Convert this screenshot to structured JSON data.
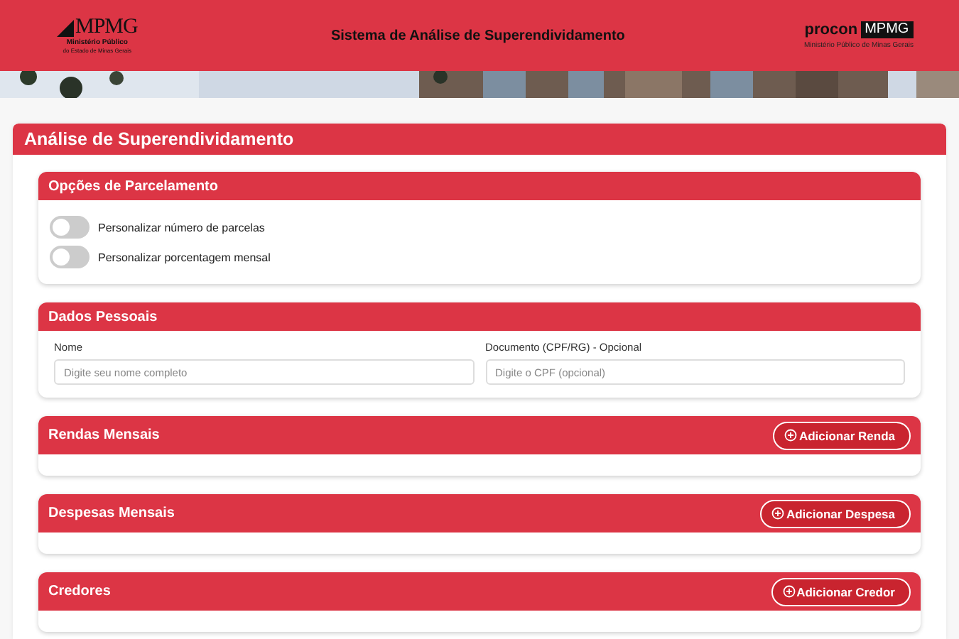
{
  "header": {
    "logo_left": {
      "mark": "MPMG",
      "line1": "Ministério Público",
      "line2": "do Estado de Minas Gerais"
    },
    "title": "Sistema de Análise de Superendividamento",
    "logo_right": {
      "word": "procon",
      "tag": "MPMG",
      "line": "Ministério Público de Minas Gerais"
    }
  },
  "main": {
    "title": "Análise de Superendividamento",
    "sections": [
      {
        "kind": "toggles",
        "title": "Opções de Parcelamento",
        "toggles": [
          {
            "label": "Personalizar número de parcelas",
            "on": false
          },
          {
            "label": "Personalizar porcentagem mensal",
            "on": false
          }
        ]
      },
      {
        "kind": "fields",
        "title": "Dados Pessoais",
        "fields": [
          {
            "label": "Nome",
            "placeholder": "Digite seu nome completo"
          },
          {
            "label": "Documento (CPF/RG) - Opcional",
            "placeholder": "Digite o CPF (opcional)"
          }
        ]
      },
      {
        "kind": "list",
        "title": "Rendas Mensais",
        "button": "Adicionar Renda"
      },
      {
        "kind": "list",
        "title": "Despesas Mensais",
        "button": "Adicionar Despesa"
      },
      {
        "kind": "list",
        "title": "Credores",
        "button": "Adicionar Credor"
      }
    ]
  }
}
